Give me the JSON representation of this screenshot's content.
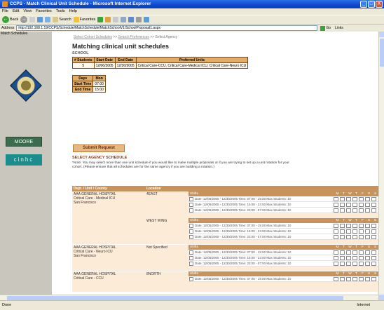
{
  "window": {
    "title": "CCPS - Match Clinical Unit Schedule - Microsoft Internet Explorer",
    "minimize": "_",
    "maximize": "□",
    "close": "X"
  },
  "menu": [
    "File",
    "Edit",
    "View",
    "Favorites",
    "Tools",
    "Help"
  ],
  "toolbar": {
    "back": "Back",
    "search": "Search",
    "favorites": "Favorites"
  },
  "address": {
    "label": "Address",
    "url": "http://192.168.1.19/CCPS/Schedule/MatchSchedule/MatchSchoolV1/SchoolProposal1.aspx",
    "go": "Go",
    "links": "Links"
  },
  "frame_title": "Match Schedules",
  "left": {
    "moore": "MOORE",
    "cinhc": "cinhc"
  },
  "breadcrumb": {
    "item1": "Select Cohort Schedules",
    "sep": ">>",
    "item2": "Search Preferences",
    "item3": "Select Agency"
  },
  "page_title": "Matching clinical unit schedules",
  "school_label": "SCHOOL",
  "summary": {
    "headers": [
      "# Students",
      "Start Date",
      "End Date",
      "Preferred Units"
    ],
    "row": [
      "5",
      "12/06/2005",
      "12/30/2005",
      "Critical Care-CCU, Critical Care-Medical ICU, Critical Care-Neuro ICU"
    ]
  },
  "days_table": {
    "headers": [
      "Days",
      "Mon"
    ],
    "rows": [
      [
        "Start Time",
        "07:00"
      ],
      [
        "End Time",
        "15:00"
      ]
    ]
  },
  "submit_label": "Submit Request",
  "agency_heading": "SELECT AGENCY SCHEDULE",
  "note": "*Note: You may select more than one unit schedule if you would like to make multiple proposals or if you are trying to set up a unit rotation for your cohort. (Please ensure that all schedules are for the same agency if you are building a rotation.)",
  "schedule": {
    "col_dept": "Dept. / Unit / County",
    "col_location": "Location",
    "shifts_label": "Shifts",
    "days": [
      "M",
      "T",
      "W",
      "T",
      "F",
      "S",
      "S"
    ],
    "groups": [
      {
        "hospital": "AAA GENERAL HOSPITAL",
        "unit": "Critical Care - Medical ICU",
        "county": "San Francisco",
        "locations": [
          {
            "name": "4EAST",
            "shifts": [
              "Date: 12/06/2005 - 12/30/2005 Time: 07:00 - 15:00 Max Students: 10",
              "Date: 12/05/2005 - 12/30/2005 Time: 15:00 - 23:00 Max Students: 10",
              "Date: 12/05/2005 - 12/30/2005 Time: 23:00 - 07:00 Max Students: 10"
            ]
          },
          {
            "name": "WEST WING",
            "shifts": [
              "Date: 12/05/2005 - 12/30/2005 Time: 07:00 - 15:00 Max Students: 10",
              "Date: 12/05/2005 - 12/30/2005 Time: 15:00 - 23:00 Max Students: 10",
              "Date: 12/05/2005 - 12/30/2005 Time: 23:00 - 07:00 Max Students: 10"
            ]
          }
        ]
      },
      {
        "hospital": "AAA GENERAL HOSPITAL",
        "unit": "Critical Care - Neuro ICU",
        "county": "San Francisco",
        "locations": [
          {
            "name": "Not Specified",
            "shifts": [
              "Date: 12/05/2005 - 12/30/2005 Time: 07:00 - 15:00 Max Students: 10",
              "Date: 12/05/2005 - 12/30/2005 Time: 15:00 - 23:00 Max Students: 10",
              "Date: 12/05/2005 - 12/30/2005 Time: 23:00 - 07:00 Max Students: 10"
            ]
          }
        ]
      },
      {
        "hospital": "AAA GENERAL HOSPITAL",
        "unit": "Critical Care - CCU",
        "county": "",
        "locations": [
          {
            "name": "8NORTH",
            "shifts": [
              "Date: 12/05/2005 - 12/30/2005 Time: 07:00 - 15:00 Max Students: 10"
            ]
          }
        ]
      }
    ]
  },
  "status": {
    "left": "Done",
    "zone": "Internet"
  }
}
